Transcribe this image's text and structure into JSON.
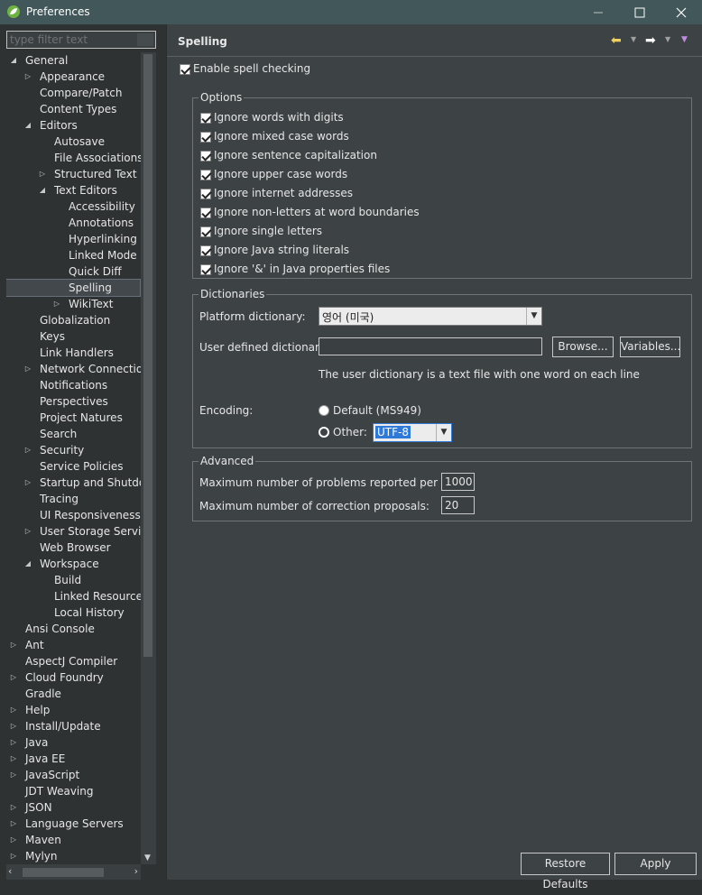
{
  "window": {
    "title": "Preferences"
  },
  "filter": {
    "placeholder": "type filter text"
  },
  "tree": [
    {
      "label": "General",
      "level": 0,
      "twisty": "expanded"
    },
    {
      "label": "Appearance",
      "level": 1,
      "twisty": "collapsed"
    },
    {
      "label": "Compare/Patch",
      "level": 1,
      "twisty": "none"
    },
    {
      "label": "Content Types",
      "level": 1,
      "twisty": "none"
    },
    {
      "label": "Editors",
      "level": 1,
      "twisty": "expanded"
    },
    {
      "label": "Autosave",
      "level": 2,
      "twisty": "none"
    },
    {
      "label": "File Associations",
      "level": 2,
      "twisty": "none"
    },
    {
      "label": "Structured Text Ed",
      "level": 2,
      "twisty": "collapsed"
    },
    {
      "label": "Text Editors",
      "level": 2,
      "twisty": "expanded"
    },
    {
      "label": "Accessibility",
      "level": 3,
      "twisty": "none"
    },
    {
      "label": "Annotations",
      "level": 3,
      "twisty": "none"
    },
    {
      "label": "Hyperlinking",
      "level": 3,
      "twisty": "none"
    },
    {
      "label": "Linked Mode",
      "level": 3,
      "twisty": "none"
    },
    {
      "label": "Quick Diff",
      "level": 3,
      "twisty": "none"
    },
    {
      "label": "Spelling",
      "level": 3,
      "twisty": "none",
      "selected": true
    },
    {
      "label": "WikiText",
      "level": 3,
      "twisty": "collapsed"
    },
    {
      "label": "Globalization",
      "level": 1,
      "twisty": "none"
    },
    {
      "label": "Keys",
      "level": 1,
      "twisty": "none"
    },
    {
      "label": "Link Handlers",
      "level": 1,
      "twisty": "none"
    },
    {
      "label": "Network Connections",
      "level": 1,
      "twisty": "collapsed"
    },
    {
      "label": "Notifications",
      "level": 1,
      "twisty": "none"
    },
    {
      "label": "Perspectives",
      "level": 1,
      "twisty": "none"
    },
    {
      "label": "Project Natures",
      "level": 1,
      "twisty": "none"
    },
    {
      "label": "Search",
      "level": 1,
      "twisty": "none"
    },
    {
      "label": "Security",
      "level": 1,
      "twisty": "collapsed"
    },
    {
      "label": "Service Policies",
      "level": 1,
      "twisty": "none"
    },
    {
      "label": "Startup and Shutdown",
      "level": 1,
      "twisty": "collapsed"
    },
    {
      "label": "Tracing",
      "level": 1,
      "twisty": "none"
    },
    {
      "label": "UI Responsiveness M",
      "level": 1,
      "twisty": "none"
    },
    {
      "label": "User Storage Service",
      "level": 1,
      "twisty": "collapsed"
    },
    {
      "label": "Web Browser",
      "level": 1,
      "twisty": "none"
    },
    {
      "label": "Workspace",
      "level": 1,
      "twisty": "expanded"
    },
    {
      "label": "Build",
      "level": 2,
      "twisty": "none"
    },
    {
      "label": "Linked Resources",
      "level": 2,
      "twisty": "none"
    },
    {
      "label": "Local History",
      "level": 2,
      "twisty": "none"
    },
    {
      "label": "Ansi Console",
      "level": 0,
      "twisty": "none"
    },
    {
      "label": "Ant",
      "level": 0,
      "twisty": "collapsed"
    },
    {
      "label": "AspectJ Compiler",
      "level": 0,
      "twisty": "none"
    },
    {
      "label": "Cloud Foundry",
      "level": 0,
      "twisty": "collapsed"
    },
    {
      "label": "Gradle",
      "level": 0,
      "twisty": "none"
    },
    {
      "label": "Help",
      "level": 0,
      "twisty": "collapsed"
    },
    {
      "label": "Install/Update",
      "level": 0,
      "twisty": "collapsed"
    },
    {
      "label": "Java",
      "level": 0,
      "twisty": "collapsed"
    },
    {
      "label": "Java EE",
      "level": 0,
      "twisty": "collapsed"
    },
    {
      "label": "JavaScript",
      "level": 0,
      "twisty": "collapsed"
    },
    {
      "label": "JDT Weaving",
      "level": 0,
      "twisty": "none"
    },
    {
      "label": "JSON",
      "level": 0,
      "twisty": "collapsed"
    },
    {
      "label": "Language Servers",
      "level": 0,
      "twisty": "collapsed"
    },
    {
      "label": "Maven",
      "level": 0,
      "twisty": "collapsed"
    },
    {
      "label": "Mylyn",
      "level": 0,
      "twisty": "collapsed"
    }
  ],
  "page": {
    "title": "Spelling",
    "enable_label": "Enable spell checking",
    "enable_checked": true,
    "options_legend": "Options",
    "options": [
      {
        "label": "Ignore words with digits",
        "checked": true
      },
      {
        "label": "Ignore mixed case words",
        "checked": true
      },
      {
        "label": "Ignore sentence capitalization",
        "checked": true
      },
      {
        "label": "Ignore upper case words",
        "checked": true
      },
      {
        "label": "Ignore internet addresses",
        "checked": true
      },
      {
        "label": "Ignore non-letters at word boundaries",
        "checked": true
      },
      {
        "label": "Ignore single letters",
        "checked": true
      },
      {
        "label": "Ignore Java string literals",
        "checked": true
      },
      {
        "label": "Ignore '&' in Java properties files",
        "checked": true
      }
    ],
    "dictionaries": {
      "legend": "Dictionaries",
      "platform_label": "Platform dictionary:",
      "platform_value": "영어 (미국)",
      "user_label": "User defined dictionary:",
      "user_value": "",
      "browse_label": "Browse...",
      "variables_label": "Variables...",
      "hint": "The user dictionary is a text file with one word on each line",
      "encoding_label": "Encoding:",
      "default_label": "Default (MS949)",
      "other_label": "Other:",
      "other_value": "UTF-8",
      "selected_encoding": "other"
    },
    "advanced": {
      "legend": "Advanced",
      "max_problems_label": "Maximum number of problems reported per file:",
      "max_problems_value": "1000",
      "max_proposals_label": "Maximum number of correction proposals:",
      "max_proposals_value": "20"
    },
    "buttons": {
      "restore_defaults": "Restore Defaults",
      "apply": "Apply"
    }
  },
  "icons": {
    "app": "spring-leaf-icon",
    "back": "back-arrow-icon",
    "forward": "forward-arrow-icon",
    "menu": "view-menu-icon"
  },
  "colors": {
    "accent_back": "#f0d060",
    "menu": "#c08ee0",
    "selection": "#2f7ad8"
  }
}
